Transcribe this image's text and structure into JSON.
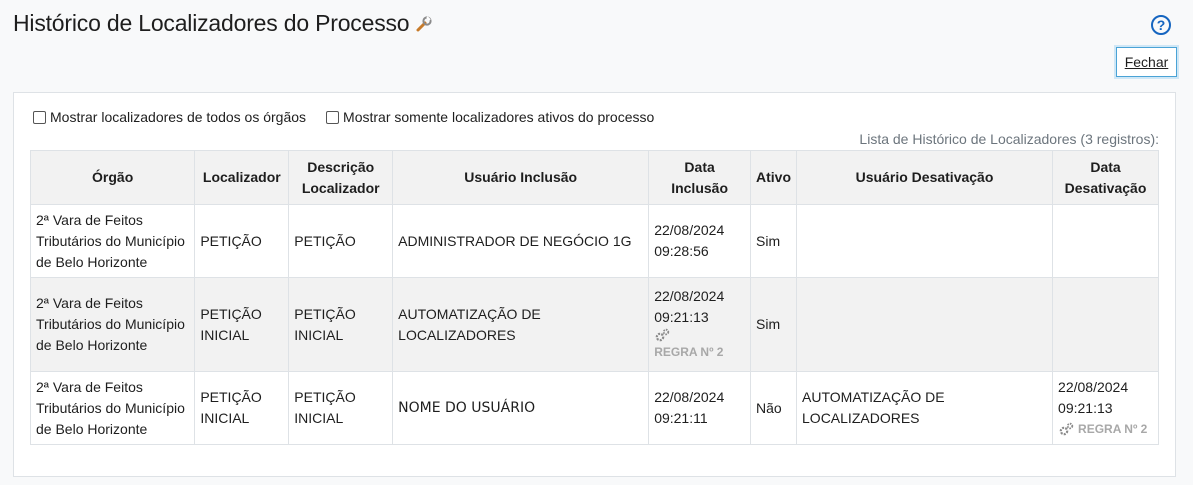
{
  "page": {
    "title": "Histórico de Localizadores do Processo",
    "help_label": "?",
    "close_label": "Fechar"
  },
  "filters": {
    "all_orgs_label": "Mostrar localizadores de todos os órgãos",
    "active_only_label": "Mostrar somente localizadores ativos do processo"
  },
  "table": {
    "caption": "Lista de Histórico de Localizadores (3 registros):",
    "headers": {
      "orgao": "Órgão",
      "localizador": "Localizador",
      "descricao": "Descrição Localizador",
      "usuario_inclusao": "Usuário Inclusão",
      "data_inclusao": "Data Inclusão",
      "ativo": "Ativo",
      "usuario_desativacao": "Usuário Desativação",
      "data_desativacao": "Data Desativação"
    },
    "rows": [
      {
        "orgao": "2ª Vara de Feitos Tributários do Município de Belo Horizonte",
        "localizador": "PETIÇÃO",
        "descricao": "PETIÇÃO",
        "usuario_inclusao": "ADMINISTRADOR DE NEGÓCIO 1G",
        "data_inclusao_date": "22/08/2024",
        "data_inclusao_time": "09:28:56",
        "ativo": "Sim",
        "usuario_desativacao": "",
        "data_desativacao": ""
      },
      {
        "orgao": "2ª Vara de Feitos Tributários do Município de Belo Horizonte",
        "localizador": "PETIÇÃO INICIAL",
        "descricao": "PETIÇÃO INICIAL",
        "usuario_inclusao": "AUTOMATIZAÇÃO DE LOCALIZADORES",
        "data_inclusao_date": "22/08/2024",
        "data_inclusao_time": "09:21:13",
        "data_inclusao_rule": "REGRA Nº 2",
        "ativo": "Sim",
        "usuario_desativacao": "",
        "data_desativacao": ""
      },
      {
        "orgao": "2ª Vara de Feitos Tributários do Município de Belo Horizonte",
        "localizador": "PETIÇÃO INICIAL",
        "descricao": "PETIÇÃO INICIAL",
        "usuario_inclusao": "NOME DO USUÁRIO",
        "data_inclusao_date": "22/08/2024",
        "data_inclusao_time": "09:21:11",
        "ativo": "Não",
        "usuario_desativacao": "AUTOMATIZAÇÃO DE LOCALIZADORES",
        "data_desativacao_date": "22/08/2024",
        "data_desativacao_time": "09:21:13",
        "data_desativacao_rule": "REGRA Nº 2"
      }
    ]
  },
  "colors": {
    "accent": "#1565c0",
    "header_bg": "#f2f2f2",
    "rule_text": "#a8a8a8"
  }
}
